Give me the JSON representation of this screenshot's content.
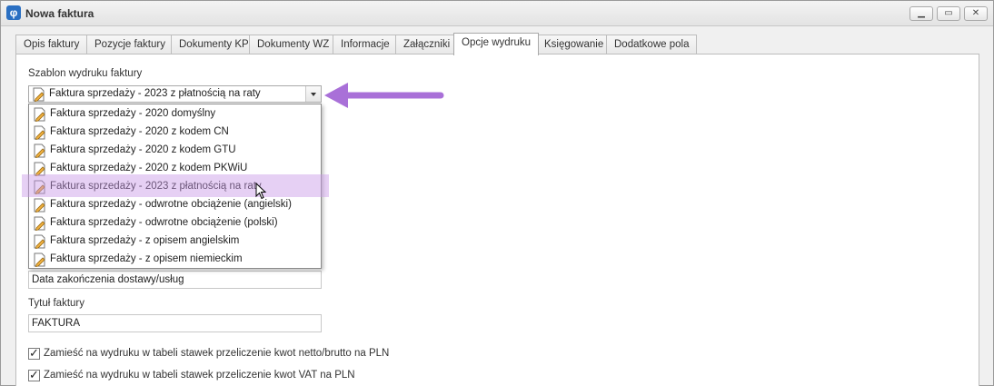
{
  "window": {
    "title": "Nowa faktura",
    "app_icon_glyph": "φ",
    "buttons": [
      "minimize-icon",
      "maximize-icon",
      "close-icon"
    ]
  },
  "tabs": [
    {
      "label": "Opis faktury",
      "active": false
    },
    {
      "label": "Pozycje faktury",
      "active": false
    },
    {
      "label": "Dokumenty KP",
      "active": false
    },
    {
      "label": "Dokumenty WZ",
      "active": false
    },
    {
      "label": "Informacje",
      "active": false
    },
    {
      "label": "Załączniki",
      "active": false
    },
    {
      "label": "Opcje wydruku",
      "active": true
    },
    {
      "label": "Księgowanie",
      "active": false
    },
    {
      "label": "Dodatkowe pola",
      "active": false
    }
  ],
  "template": {
    "label": "Szablon wydruku faktury",
    "selected": "Faktura sprzedaży - 2023 z płatnością na raty",
    "options": [
      "Faktura sprzedaży - 2020 domyślny",
      "Faktura sprzedaży - 2020 z kodem CN",
      "Faktura sprzedaży - 2020 z kodem GTU",
      "Faktura sprzedaży - 2020 z kodem PKWiU",
      "Faktura sprzedaży - 2023 z płatnością na raty",
      "Faktura sprzedaży - odwrotne obciążenie (angielski)",
      "Faktura sprzedaży - odwrotne obciążenie (polski)",
      "Faktura sprzedaży - z opisem angielskim",
      "Faktura sprzedaży - z opisem niemieckim"
    ],
    "hovered_index": 4
  },
  "delivery_date_field": {
    "value": "Data zakończenia dostawy/usług"
  },
  "invoice_title": {
    "label": "Tytuł faktury",
    "value": "FAKTURA"
  },
  "checkboxes": [
    {
      "label": "Zamieść na wydruku w tabeli stawek przeliczenie kwot netto/brutto na PLN",
      "checked": true
    },
    {
      "label": "Zamieść na wydruku w tabeli stawek przeliczenie kwot VAT na PLN",
      "checked": true
    }
  ],
  "colors": {
    "highlight": "#c896e6",
    "arrow": "#a970d8",
    "accent": "#2a6fc2"
  }
}
